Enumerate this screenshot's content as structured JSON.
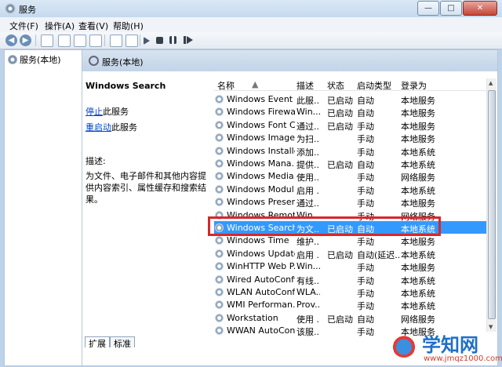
{
  "window": {
    "title": "服务",
    "controls": [
      "—",
      "□",
      "✕"
    ]
  },
  "menu": [
    "文件(F)",
    "操作(A)",
    "查看(V)",
    "帮助(H)"
  ],
  "nav": {
    "item": "服务(本地)"
  },
  "content_header": "服务(本地)",
  "detail": {
    "name": "Windows Search",
    "stop_link": "停止",
    "stop_suffix": "此服务",
    "restart_link": "重启动",
    "restart_suffix": "此服务",
    "desc_label": "描述:",
    "desc_text": "为文件、电子邮件和其他内容提供内容索引、属性缓存和搜索结果。"
  },
  "columns": [
    "名称",
    "描述",
    "状态",
    "启动类型",
    "登录为"
  ],
  "rows": [
    {
      "name": "Windows Event ...",
      "desc": "此服...",
      "status": "已启动",
      "start": "自动",
      "logon": "本地服务"
    },
    {
      "name": "Windows Firewall",
      "desc": "Win...",
      "status": "已启动",
      "start": "自动",
      "logon": "本地服务"
    },
    {
      "name": "Windows Font C...",
      "desc": "通过...",
      "status": "已启动",
      "start": "手动",
      "logon": "本地服务"
    },
    {
      "name": "Windows Image...",
      "desc": "为扫...",
      "status": "",
      "start": "手动",
      "logon": "本地服务"
    },
    {
      "name": "Windows Installer",
      "desc": "添加...",
      "status": "",
      "start": "手动",
      "logon": "本地系统"
    },
    {
      "name": "Windows Mana...",
      "desc": "提供...",
      "status": "已启动",
      "start": "自动",
      "logon": "本地系统"
    },
    {
      "name": "Windows Media...",
      "desc": "使用...",
      "status": "",
      "start": "手动",
      "logon": "网络服务"
    },
    {
      "name": "Windows Modul...",
      "desc": "启用 ...",
      "status": "",
      "start": "手动",
      "logon": "本地系统"
    },
    {
      "name": "Windows Presen...",
      "desc": "通过...",
      "status": "",
      "start": "手动",
      "logon": "本地服务"
    },
    {
      "name": "Windows Remot...",
      "desc": "Win...",
      "status": "",
      "start": "手动",
      "logon": "网络服务"
    },
    {
      "name": "Windows Search",
      "desc": "为文...",
      "status": "已启动",
      "start": "自动",
      "logon": "本地系统",
      "selected": true
    },
    {
      "name": "Windows Time",
      "desc": "维护...",
      "status": "",
      "start": "手动",
      "logon": "本地服务"
    },
    {
      "name": "Windows Update",
      "desc": "启用 ...",
      "status": "已启动",
      "start": "自动(延迟...",
      "logon": "本地系统"
    },
    {
      "name": "WinHTTP Web P...",
      "desc": "Win...",
      "status": "",
      "start": "手动",
      "logon": "本地服务"
    },
    {
      "name": "Wired AutoConfig",
      "desc": "有线...",
      "status": "",
      "start": "手动",
      "logon": "本地系统"
    },
    {
      "name": "WLAN AutoConfig",
      "desc": "WLA...",
      "status": "",
      "start": "手动",
      "logon": "本地系统"
    },
    {
      "name": "WMI Performan...",
      "desc": "Prov...",
      "status": "",
      "start": "手动",
      "logon": "本地系统"
    },
    {
      "name": "Workstation",
      "desc": "使用 ...",
      "status": "已启动",
      "start": "自动",
      "logon": "网络服务"
    },
    {
      "name": "WWAN AutoCon...",
      "desc": "该服...",
      "status": "",
      "start": "手动",
      "logon": "本地服务"
    }
  ],
  "tabs": [
    "扩展",
    "标准"
  ],
  "watermark": {
    "main": "学知网",
    "sub": "www.jmqz1000.com"
  }
}
